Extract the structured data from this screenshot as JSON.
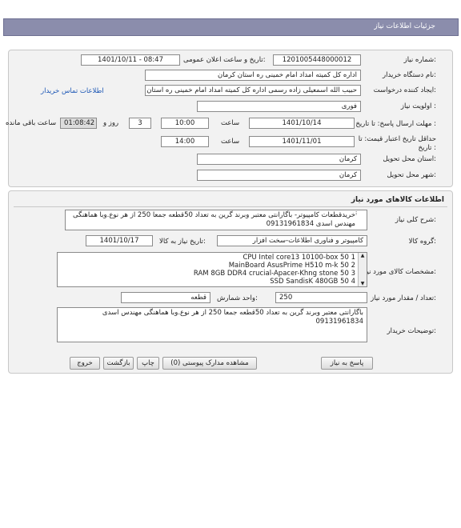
{
  "header": {
    "title": "جزئیات اطلاعات نیاز"
  },
  "info": {
    "need_number_label": "شماره نیاز:",
    "need_number": "1201005448000012",
    "announce_label": "تاریخ و ساعت اعلان عمومی:",
    "announce_value": "1401/10/11 - 08:47",
    "buyer_org_label": "نام دستگاه خریدار:",
    "buyer_org": "اداره کل کمیته امداد امام خمینی  ره  استان کرمان",
    "requester_label": "ایجاد کننده درخواست:",
    "requester": "حبیب الله اسمعیلی زاده رسمی  اداره کل کمیته امداد امام خمینی  ره  استان کرمان",
    "contact_link": "اطلاعات تماس خریدار",
    "priority_label": "اولویت نیاز :",
    "priority": "فوری",
    "deadline_label": "مهلت ارسال پاسخ: تا تاریخ :",
    "deadline_date": "1401/10/14",
    "time_label": "ساعت",
    "deadline_time": "10:00",
    "days": "3",
    "days_label": "روز و",
    "remaining": "01:08:42",
    "remaining_label": "ساعت باقی مانده",
    "validity_label": "حداقل تاریخ اعتبار قیمت: تا تاریخ :",
    "validity_date": "1401/11/01",
    "validity_time_label": "ساعت",
    "validity_time": "14:00",
    "province_label": "استان محل تحویل:",
    "province": "کرمان",
    "city_label": "شهر محل تحویل:",
    "city": "کرمان"
  },
  "goods": {
    "title": "اطلاعات کالاهای مورد نیاز",
    "summary_label": "شرح کلی نیاز:",
    "summary": "خریدقطعات کامپیوتر- باگارانتی معتبر وبرند گرین به تعداد 50قطعه جمعا 250 از هر نوع.وبا هماهنگی مهندس اسدی 09131961834",
    "group_label": "گروه کالا:",
    "group": "کامپیوتر و فناوری اطلاعات-سخت افزار",
    "need_date_label": "تاریخ نیاز به کالا:",
    "need_date": "1401/10/17",
    "specs_label": "مشخصات کالای مورد نیاز:",
    "specs": [
      "CPU Intel core13 10100-box 50 1",
      "MainBoard AsusPrime  H510 m-k 50 2",
      "RAM 8GB DDR4 crucial-Apacer-Khng stone 50 3",
      "SSD SandisK 480GB 50 4"
    ],
    "qty_label": "تعداد / مقدار مورد نیاز:",
    "qty": "250",
    "unit_label": "واحد شمارش:",
    "unit": "قطعه",
    "buyer_desc_label": "توضیحات خریدار:",
    "buyer_desc": "باگارانتی معتبر وبرند گرین به تعداد 50قطعه جمعا 250 از هر نوع.وبا هماهنگی مهندس اسدی 09131961834"
  },
  "buttons": {
    "reply": "پاسخ به نیاز",
    "attachments": "مشاهده مدارک پیوستی (0)",
    "print": "چاپ",
    "back": "بازگشت",
    "exit": "خروج"
  }
}
